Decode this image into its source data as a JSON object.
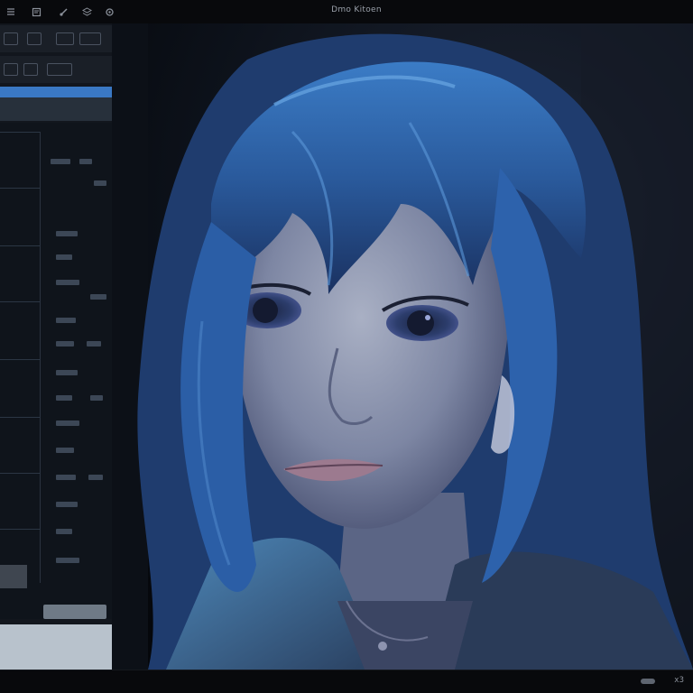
{
  "window": {
    "title": "Dmo Kitoen"
  },
  "toolbar": {
    "icons": [
      "menu-icon",
      "page-icon",
      "brush-icon",
      "layers-icon",
      "settings-icon"
    ]
  },
  "status": {
    "value": "x3"
  },
  "colors": {
    "accent": "#3a78c4",
    "hair": "#2f63a8",
    "background": "#0a0d12"
  }
}
